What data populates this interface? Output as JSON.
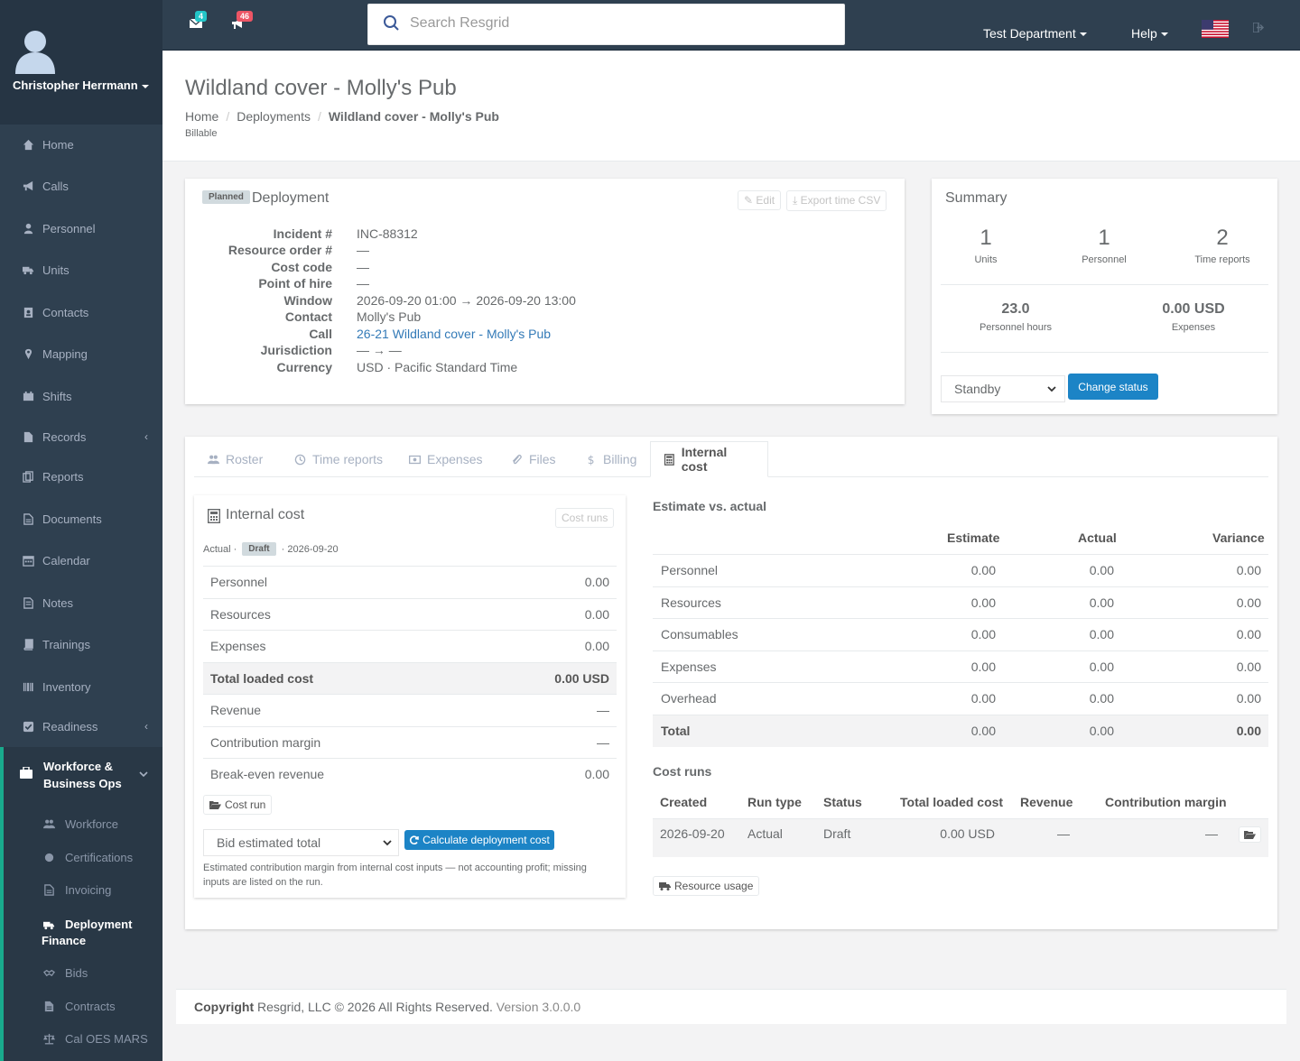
{
  "user": {
    "name": "Christopher Herrmann"
  },
  "nav": {
    "items": [
      {
        "label": "Home",
        "icon": "home-icon"
      },
      {
        "label": "Calls",
        "icon": "bullhorn-icon"
      },
      {
        "label": "Personnel",
        "icon": "user-icon"
      },
      {
        "label": "Units",
        "icon": "truck-icon"
      },
      {
        "label": "Contacts",
        "icon": "address-book-icon"
      },
      {
        "label": "Mapping",
        "icon": "map-marker-icon"
      },
      {
        "label": "Shifts",
        "icon": "shifts-icon"
      },
      {
        "label": "Records",
        "icon": "file-icon"
      },
      {
        "label": "Reports",
        "icon": "reports-icon"
      },
      {
        "label": "Documents",
        "icon": "document-icon"
      },
      {
        "label": "Calendar",
        "icon": "calendar-icon"
      },
      {
        "label": "Notes",
        "icon": "notes-icon"
      },
      {
        "label": "Trainings",
        "icon": "book-icon"
      },
      {
        "label": "Inventory",
        "icon": "barcode-icon"
      },
      {
        "label": "Readiness",
        "icon": "check-square-icon"
      }
    ],
    "ops_group": {
      "label_line1": "Workforce &",
      "label_line2": "Business Ops",
      "items": [
        {
          "label": "Workforce",
          "icon": "users-icon"
        },
        {
          "label": "Certifications",
          "icon": "certificate-icon"
        },
        {
          "label": "Invoicing",
          "icon": "invoice-icon"
        },
        {
          "label_line1": "Deployment",
          "label_line2": "Finance",
          "icon": "truck-icon"
        },
        {
          "label": "Bids",
          "icon": "handshake-icon"
        },
        {
          "label": "Contracts",
          "icon": "contract-icon"
        },
        {
          "label": "Cal OES MARS",
          "icon": "balance-scale-icon"
        }
      ]
    }
  },
  "topbar": {
    "messages_count": "4",
    "notifications_count": "46",
    "search_placeholder": "Search Resgrid",
    "department": "Test Department",
    "help": "Help"
  },
  "page": {
    "title": "Wildland cover - Molly's Pub",
    "breadcrumb": [
      "Home",
      "Deployments",
      "Wildland cover - Molly's Pub"
    ],
    "subtitle": "Billable"
  },
  "deployment": {
    "status_tag": "Planned",
    "heading": "Deployment",
    "edit_label": "Edit",
    "export_label": "Export time CSV",
    "fields": [
      {
        "label": "Incident #",
        "value": "INC-88312"
      },
      {
        "label": "Resource order #",
        "value": "—"
      },
      {
        "label": "Cost code",
        "value": "—"
      },
      {
        "label": "Point of hire",
        "value": "—"
      },
      {
        "label": "Window",
        "value": "2026-09-20 01:00 → 2026-09-20 13:00"
      },
      {
        "label": "Contact",
        "value": "Molly's Pub"
      },
      {
        "label": "Call",
        "value": "26-21 Wildland cover - Molly's Pub"
      },
      {
        "label": "Jurisdiction",
        "value": "— → —"
      },
      {
        "label": "Currency",
        "value": "USD · Pacific Standard Time"
      }
    ]
  },
  "summary": {
    "heading": "Summary",
    "stats": [
      {
        "value": "1",
        "label": "Units"
      },
      {
        "value": "1",
        "label": "Personnel"
      },
      {
        "value": "2",
        "label": "Time reports"
      },
      {
        "value": "23.0",
        "label": "Personnel hours"
      },
      {
        "value": "0.00 USD",
        "label": "Expenses"
      }
    ],
    "status_selected": "Standby",
    "change_status_label": "Change status"
  },
  "tabs": [
    {
      "label": "Roster",
      "icon": "users-icon"
    },
    {
      "label": "Time reports",
      "icon": "clock-icon"
    },
    {
      "label": "Expenses",
      "icon": "money-icon"
    },
    {
      "label": "Files",
      "icon": "paperclip-icon"
    },
    {
      "label": "Billing",
      "icon": "dollar-icon"
    },
    {
      "label": "Internal cost",
      "icon": "calculator-icon"
    }
  ],
  "internal_cost": {
    "heading": "Internal cost",
    "cost_runs_btn": "Cost runs",
    "meta_actual": "Actual ·",
    "meta_tag": "Draft",
    "meta_date": "· 2026-09-20",
    "rows": [
      {
        "label": "Personnel",
        "value": "0.00"
      },
      {
        "label": "Resources",
        "value": "0.00"
      },
      {
        "label": "Expenses",
        "value": "0.00"
      },
      {
        "label": "Total loaded cost",
        "value": "0.00 USD"
      },
      {
        "label": "Revenue",
        "value": "—"
      },
      {
        "label": "Contribution margin",
        "value": "—"
      },
      {
        "label": "Break-even revenue",
        "value": "0.00"
      }
    ],
    "cost_run_btn": "Cost run",
    "basis_selected": "Bid estimated total",
    "calculate_label": "Calculate deployment cost",
    "note": "Estimated contribution margin from internal cost inputs — not accounting profit; missing inputs are listed on the run."
  },
  "estimate": {
    "heading": "Estimate vs. actual",
    "columns": [
      "Estimate",
      "Actual",
      "Variance"
    ],
    "rows": [
      {
        "label": "Personnel",
        "estimate": "0.00",
        "actual": "0.00",
        "variance": "0.00"
      },
      {
        "label": "Resources",
        "estimate": "0.00",
        "actual": "0.00",
        "variance": "0.00"
      },
      {
        "label": "Consumables",
        "estimate": "0.00",
        "actual": "0.00",
        "variance": "0.00"
      },
      {
        "label": "Expenses",
        "estimate": "0.00",
        "actual": "0.00",
        "variance": "0.00"
      },
      {
        "label": "Overhead",
        "estimate": "0.00",
        "actual": "0.00",
        "variance": "0.00"
      },
      {
        "label": "Total",
        "estimate": "0.00",
        "actual": "0.00",
        "variance": "0.00"
      }
    ]
  },
  "cost_runs": {
    "heading": "Cost runs",
    "columns": [
      "Created",
      "Run type",
      "Status",
      "Total loaded cost",
      "Revenue",
      "Contribution margin"
    ],
    "rows": [
      {
        "created": "2026-09-20",
        "run_type": "Actual",
        "status": "Draft",
        "total": "0.00 USD",
        "revenue": "—",
        "margin": "—"
      }
    ],
    "resource_usage_label": "Resource usage"
  },
  "footer": {
    "copyright": "Copyright",
    "text": "Resgrid, LLC © 2026 All Rights Reserved.",
    "version": "Version 3.0.0.0"
  },
  "colors": {
    "sidebar": "#2f4050",
    "primary": "#1c84c6",
    "accent": "#19aa8d",
    "badge_info": "#23c6c8",
    "badge_danger": "#ed5565"
  }
}
